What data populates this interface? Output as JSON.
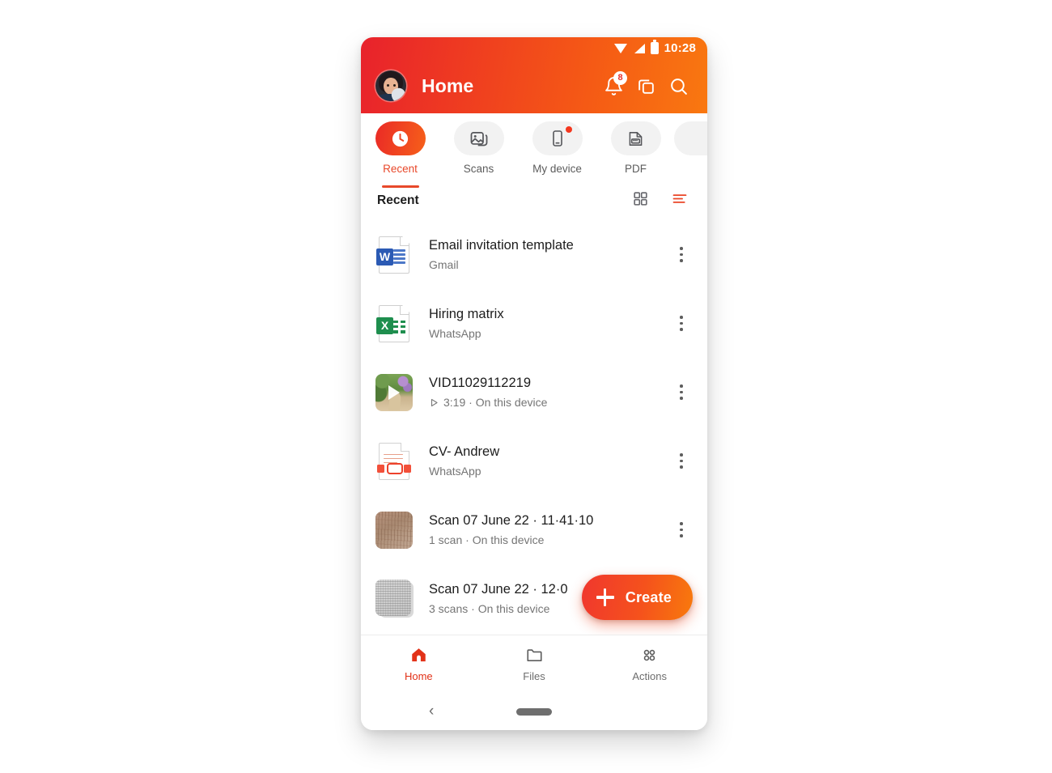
{
  "status_bar": {
    "time": "10:28",
    "icons": [
      "wifi-icon",
      "signal-icon",
      "battery-icon"
    ]
  },
  "header": {
    "title": "Home",
    "avatar": "user-avatar",
    "notifications_badge": "8",
    "actions": [
      "notifications-bell-icon",
      "copy-stack-icon",
      "search-icon"
    ]
  },
  "tabs": [
    {
      "label": "Recent",
      "icon": "clock-icon",
      "active": true,
      "dot": false
    },
    {
      "label": "Scans",
      "icon": "image-icon",
      "active": false,
      "dot": false
    },
    {
      "label": "My device",
      "icon": "phone-icon",
      "active": false,
      "dot": true
    },
    {
      "label": "PDF",
      "icon": "pdf-icon",
      "active": false,
      "dot": false
    },
    {
      "label": "",
      "icon": "more-icon",
      "active": false,
      "dot": false
    }
  ],
  "list_header": {
    "title": "Recent",
    "grid_view_icon": "grid-view-icon",
    "sort_icon": "sort-icon"
  },
  "files": [
    {
      "name": "Email invitation template",
      "sub": "Gmail",
      "icon": "word-document-icon",
      "badge": "W",
      "badge_color": "#2b5ab4"
    },
    {
      "name": "Hiring matrix",
      "sub": "WhatsApp",
      "icon": "excel-document-icon",
      "badge": "X",
      "badge_color": "#1e8e4e"
    },
    {
      "name": "VID11029112219",
      "sub": "3:19 · On this device",
      "icon": "video-thumbnail",
      "play": true
    },
    {
      "name": "CV- Andrew",
      "sub": "WhatsApp",
      "icon": "pdf-document-icon"
    },
    {
      "name": "Scan 07 June 22 · 11·41·10",
      "sub": "1 scan · On this device",
      "icon": "scan-thumbnail"
    },
    {
      "name": "Scan 07 June 22 · 12·0",
      "sub": "3 scans · On this device",
      "icon": "scan-stack-thumbnail"
    }
  ],
  "fab": {
    "label": "Create",
    "icon": "plus-icon"
  },
  "bottom_nav": [
    {
      "label": "Home",
      "icon": "home-icon",
      "active": true
    },
    {
      "label": "Files",
      "icon": "folder-icon",
      "active": false
    },
    {
      "label": "Actions",
      "icon": "actions-icon",
      "active": false
    }
  ],
  "system_nav": {
    "back_icon": "back-chevron-icon",
    "home_pill": "home-pill-indicator"
  },
  "colors": {
    "accent": "#e8482a",
    "brand_red": "#e8222c",
    "brand_orange": "#f97810",
    "word_blue": "#2b5ab4",
    "excel_green": "#1e8e4e"
  }
}
